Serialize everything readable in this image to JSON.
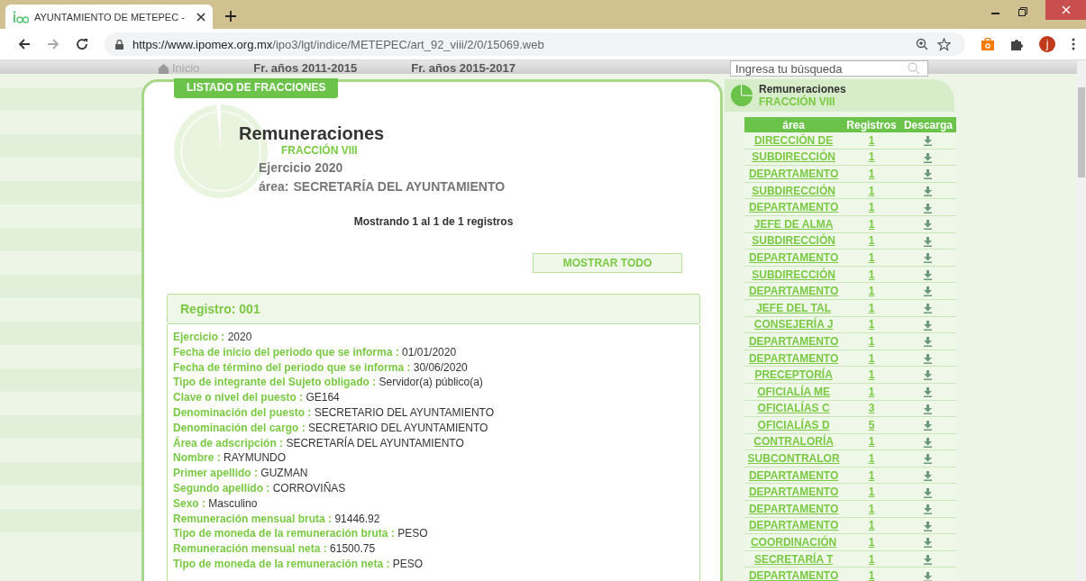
{
  "browser": {
    "tab_title": "AYUNTAMIENTO DE METEPEC -",
    "url_host": "https://www.ipomex.org.mx",
    "url_path": "/ipo3/lgt/indice/METEPEC/art_92_viii/2/0/15069.web",
    "avatar_letter": "j"
  },
  "nav": {
    "items": [
      {
        "label": "Inicio",
        "kind": "home"
      },
      {
        "label": "Fr. años 2011-2015",
        "kind": "text"
      },
      {
        "label": "Fr. años 2015-2017",
        "kind": "text"
      }
    ],
    "search": {
      "placeholder": "Ingresa tu búsqueda"
    }
  },
  "main": {
    "list_button": "LISTADO DE FRACCIONES",
    "title": "Remuneraciones",
    "fraction": "FRACCIÓN VIII",
    "exercise": "Ejercicio 2020",
    "area_label": "área:",
    "area": "SECRETARÍA DEL AYUNTAMIENTO",
    "showing": "Mostrando 1 al 1 de 1 registros",
    "show_all": "MOSTRAR TODO",
    "record": {
      "title": "Registro: 001",
      "fields": [
        {
          "label": "Ejercicio :",
          "value": "2020"
        },
        {
          "label": "Fecha de inicio del periodo que se informa :",
          "value": "01/01/2020"
        },
        {
          "label": "Fecha de término del periodo que se informa :",
          "value": "30/06/2020"
        },
        {
          "label": "Tipo de integrante del Sujeto obligado :",
          "value": "Servidor(a) público(a)"
        },
        {
          "label": "Clave o nivel del puesto :",
          "value": "GE164"
        },
        {
          "label": "Denominación del puesto :",
          "value": "SECRETARIO DEL AYUNTAMIENTO"
        },
        {
          "label": "Denominación del cargo :",
          "value": "SECRETARIO DEL AYUNTAMIENTO"
        },
        {
          "label": "Área de adscripción :",
          "value": "SECRETARÍA DEL AYUNTAMIENTO"
        },
        {
          "label": "Nombre :",
          "value": "RAYMUNDO"
        },
        {
          "label": "Primer apellido :",
          "value": "GUZMAN"
        },
        {
          "label": "Segundo apellido :",
          "value": "CORROVIÑAS"
        },
        {
          "label": "Sexo :",
          "value": "Masculino"
        },
        {
          "label": "Remuneración mensual bruta :",
          "value": "91446.92"
        },
        {
          "label": "Tipo de moneda de la remuneración bruta :",
          "value": "PESO"
        },
        {
          "label": "Remuneración mensual neta :",
          "value": "61500.75"
        },
        {
          "label": "Tipo de moneda de la remuneración neta :",
          "value": "PESO"
        }
      ]
    }
  },
  "side": {
    "title": "Remuneraciones",
    "fraction": "FRACCIÓN VIII",
    "table": {
      "columns": [
        "área",
        "Registros",
        "Descarga"
      ],
      "rows": [
        {
          "area": "DIRECCIÓN DE",
          "count": "1"
        },
        {
          "area": "SUBDIRECCIÓN",
          "count": "1"
        },
        {
          "area": "DEPARTAMENTO",
          "count": "1"
        },
        {
          "area": "SUBDIRECCIÓN",
          "count": "1"
        },
        {
          "area": "DEPARTAMENTO",
          "count": "1"
        },
        {
          "area": "JEFE DE ALMA",
          "count": "1"
        },
        {
          "area": "SUBDIRECCIÓN",
          "count": "1"
        },
        {
          "area": "DEPARTAMENTO",
          "count": "1"
        },
        {
          "area": "SUBDIRECCIÓN",
          "count": "1"
        },
        {
          "area": "DEPARTAMENTO",
          "count": "1"
        },
        {
          "area": "JEFE DEL TAL",
          "count": "1"
        },
        {
          "area": "CONSEJERÍA J",
          "count": "1"
        },
        {
          "area": "DEPARTAMENTO",
          "count": "1"
        },
        {
          "area": "DEPARTAMENTO",
          "count": "1"
        },
        {
          "area": "PRECEPTORÍA",
          "count": "1"
        },
        {
          "area": "OFICIALÍA ME",
          "count": "1"
        },
        {
          "area": "OFICIALÍAS C",
          "count": "3"
        },
        {
          "area": "OFICIALÍAS D",
          "count": "5"
        },
        {
          "area": "CONTRALORÍA",
          "count": "1"
        },
        {
          "area": "SUBCONTRALOR",
          "count": "1"
        },
        {
          "area": "DEPARTAMENTO",
          "count": "1"
        },
        {
          "area": "DEPARTAMENTO",
          "count": "1"
        },
        {
          "area": "DEPARTAMENTO",
          "count": "1"
        },
        {
          "area": "DEPARTAMENTO",
          "count": "1"
        },
        {
          "area": "COORDINACIÓN",
          "count": "1"
        },
        {
          "area": "SECRETARÍA T",
          "count": "1"
        },
        {
          "area": "DEPARTAMENTO",
          "count": "1"
        }
      ]
    }
  }
}
